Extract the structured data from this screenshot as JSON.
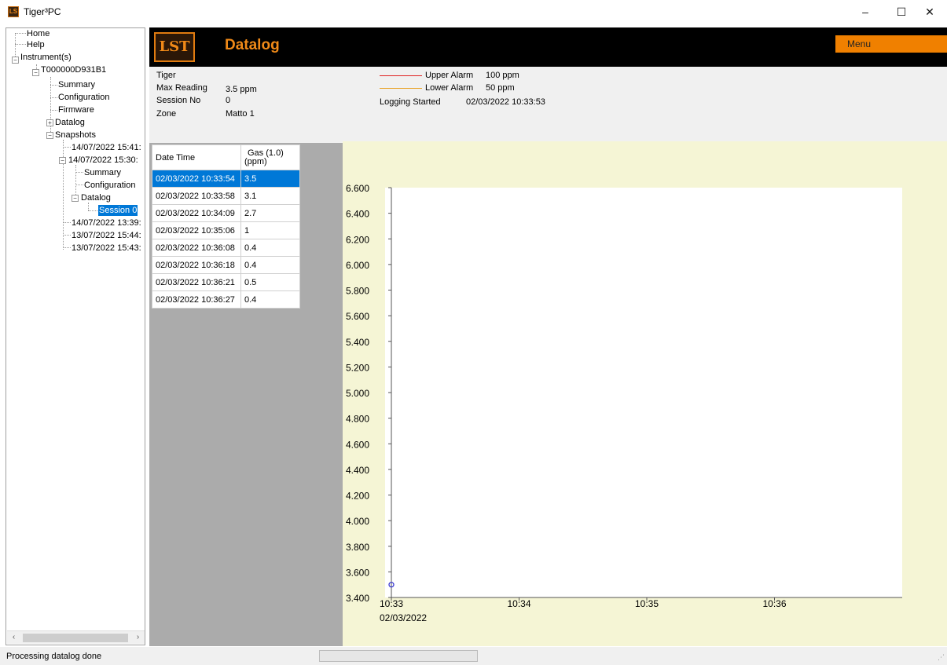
{
  "window": {
    "title": "Tiger³PC",
    "icon": "lst-logo-icon",
    "minimize": "–",
    "maximize": "☐",
    "close": "✕"
  },
  "tree": {
    "home": "Home",
    "help": "Help",
    "instruments": "Instrument(s)",
    "instrument_id": "T000000D931B1",
    "summary": "Summary",
    "configuration": "Configuration",
    "firmware": "Firmware",
    "datalog": "Datalog",
    "snapshots": "Snapshots",
    "snap1": "14/07/2022 15:41:",
    "snap2": "14/07/2022 15:30:",
    "snap2_summary": "Summary",
    "snap2_configuration": "Configuration",
    "snap2_datalog": "Datalog",
    "session": "Session 0",
    "snap3": "14/07/2022 13:39:",
    "snap4": "13/07/2022 15:44:",
    "snap5": "13/07/2022 15:43:"
  },
  "header": {
    "logo": "LST",
    "title": "Datalog",
    "menu_label": "Menu"
  },
  "info": {
    "instrument": "Tiger",
    "max_reading_label": "Max Reading",
    "max_reading_value": "3.5 ppm",
    "session_no_label": "Session No",
    "session_no_value": "0",
    "zone_label": "Zone",
    "zone_value": "Matto 1",
    "upper_alarm_label": "Upper Alarm",
    "upper_alarm_value": "100 ppm",
    "upper_alarm_color": "#e02020",
    "lower_alarm_label": "Lower Alarm",
    "lower_alarm_value": "50 ppm",
    "lower_alarm_color": "#e8a020",
    "logging_started_label": "Logging Started",
    "logging_started_value": "02/03/2022 10:33:53"
  },
  "table": {
    "col_datetime": "Date Time",
    "col_gas": "Gas (1.0)",
    "col_gas_unit": "(ppm)",
    "rows": [
      [
        "02/03/2022 10:33:54",
        "3.5"
      ],
      [
        "02/03/2022 10:33:58",
        "3.1"
      ],
      [
        "02/03/2022 10:34:09",
        "2.7"
      ],
      [
        "02/03/2022 10:35:06",
        "1"
      ],
      [
        "02/03/2022 10:36:08",
        "0.4"
      ],
      [
        "02/03/2022 10:36:18",
        "0.4"
      ],
      [
        "02/03/2022 10:36:21",
        "0.5"
      ],
      [
        "02/03/2022 10:36:27",
        "0.4"
      ]
    ]
  },
  "chart_data": {
    "type": "scatter",
    "y_ticks": [
      "6.600",
      "6.400",
      "6.200",
      "6.000",
      "5.800",
      "5.600",
      "5.400",
      "5.200",
      "5.000",
      "4.800",
      "4.600",
      "4.400",
      "4.200",
      "4.000",
      "3.800",
      "3.600",
      "3.400"
    ],
    "ylim": [
      3.4,
      6.6
    ],
    "x_ticks": [
      "10:33",
      "10:34",
      "10:35",
      "10:36"
    ],
    "x_date_label": "02/03/2022",
    "xlim": [
      "10:33:00",
      "10:37:00"
    ],
    "points": [
      {
        "x": "10:33:00",
        "y": 3.5
      }
    ],
    "point_color": "#3030d0",
    "plot_background": "#ffffff",
    "area_background": "#f5f5d5"
  },
  "status": {
    "text": "Processing datalog done"
  }
}
